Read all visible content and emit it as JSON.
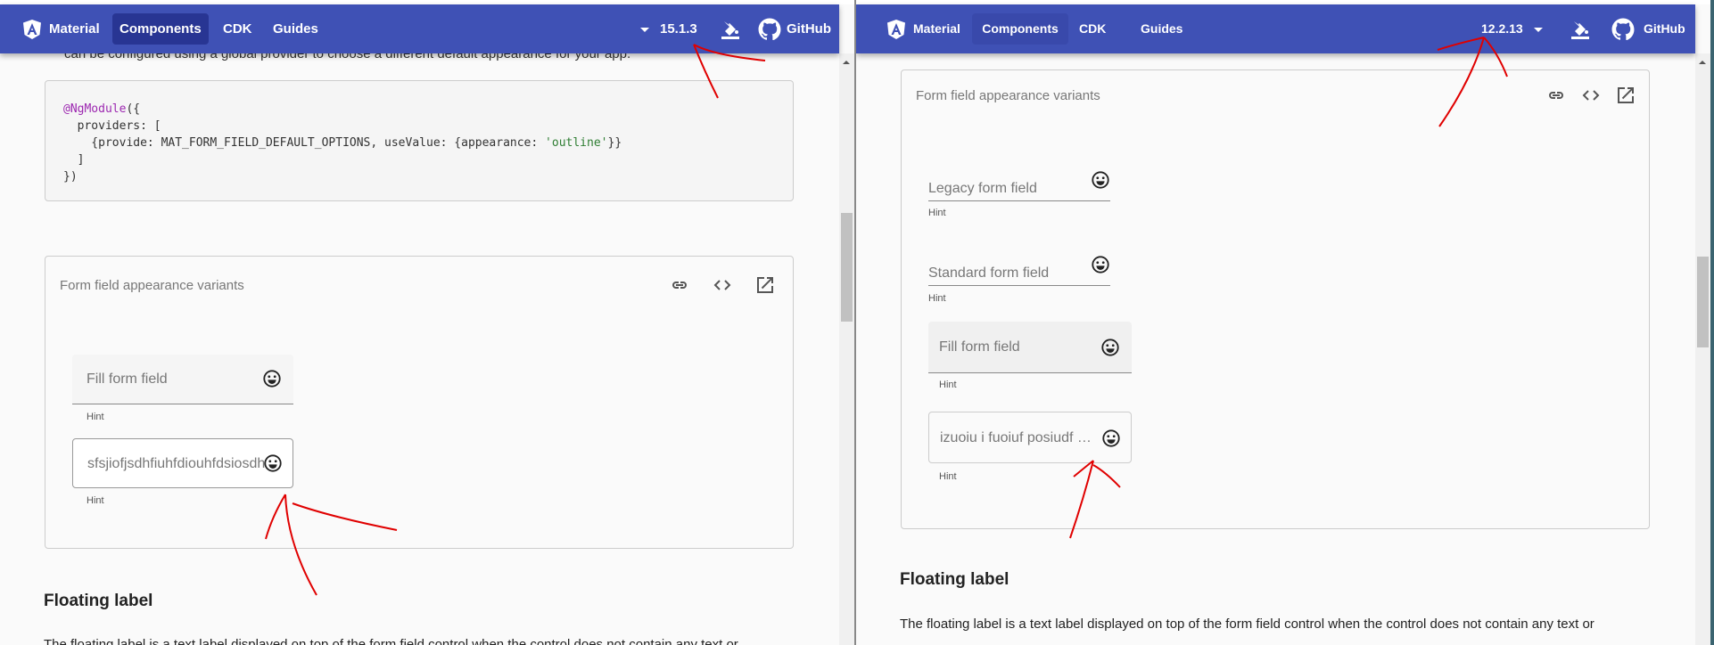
{
  "left": {
    "toolbar": {
      "brand": "Material",
      "nav": [
        "Components",
        "CDK",
        "Guides"
      ],
      "active_nav": "Components",
      "version": "15.1.3",
      "github": "GitHub"
    },
    "intro_text": "can be configured using a global provider to choose a different default appearance for your app.",
    "code": {
      "line1_kw": "@NgModule",
      "line1_rest": "({",
      "line2": "  providers: [",
      "line3_a": "    {provide: MAT_FORM_FIELD_DEFAULT_OPTIONS, useValue: {appearance: ",
      "line3_str": "'outline'",
      "line3_b": "}}",
      "line4": "  ]",
      "line5": "})"
    },
    "example": {
      "title": "Form field appearance variants",
      "fields": [
        {
          "appearance": "fill",
          "label": "Fill form field",
          "hint": "Hint"
        },
        {
          "appearance": "outline",
          "value": "sfsjiofjsdhfiuhfdiouhfdsiosdh",
          "hint": "Hint"
        }
      ]
    },
    "section_heading": "Floating label",
    "section_text": "The floating label is a text label displayed on top of the form field control when the control does not contain any text or"
  },
  "right": {
    "toolbar": {
      "brand": "Material",
      "nav": [
        "Components",
        "CDK",
        "Guides"
      ],
      "active_nav": "Components",
      "version": "12.2.13",
      "github": "GitHub"
    },
    "example": {
      "title": "Form field appearance variants",
      "fields": [
        {
          "appearance": "legacy",
          "label": "Legacy form field",
          "hint": "Hint"
        },
        {
          "appearance": "standard",
          "label": "Standard form field",
          "hint": "Hint"
        },
        {
          "appearance": "fill",
          "label": "Fill form field",
          "hint": "Hint"
        },
        {
          "appearance": "outline",
          "value": "izuoiu i fuoiuf posiudf p…",
          "hint": "Hint"
        }
      ]
    },
    "section_heading": "Floating label",
    "section_text": "The floating label is a text label displayed on top of the form field control when the control does not contain any text or"
  },
  "colors": {
    "toolbar": "#3f51b5",
    "active_nav": "#283593",
    "annotation": "#e00000"
  },
  "icons": {
    "logo": "angular-logo-icon",
    "theme": "format-color-fill-icon",
    "github": "github-icon",
    "link": "link-icon",
    "code": "code-icon",
    "open": "open-in-new-icon",
    "field_suffix": "sentiment-very-satisfied-icon"
  }
}
